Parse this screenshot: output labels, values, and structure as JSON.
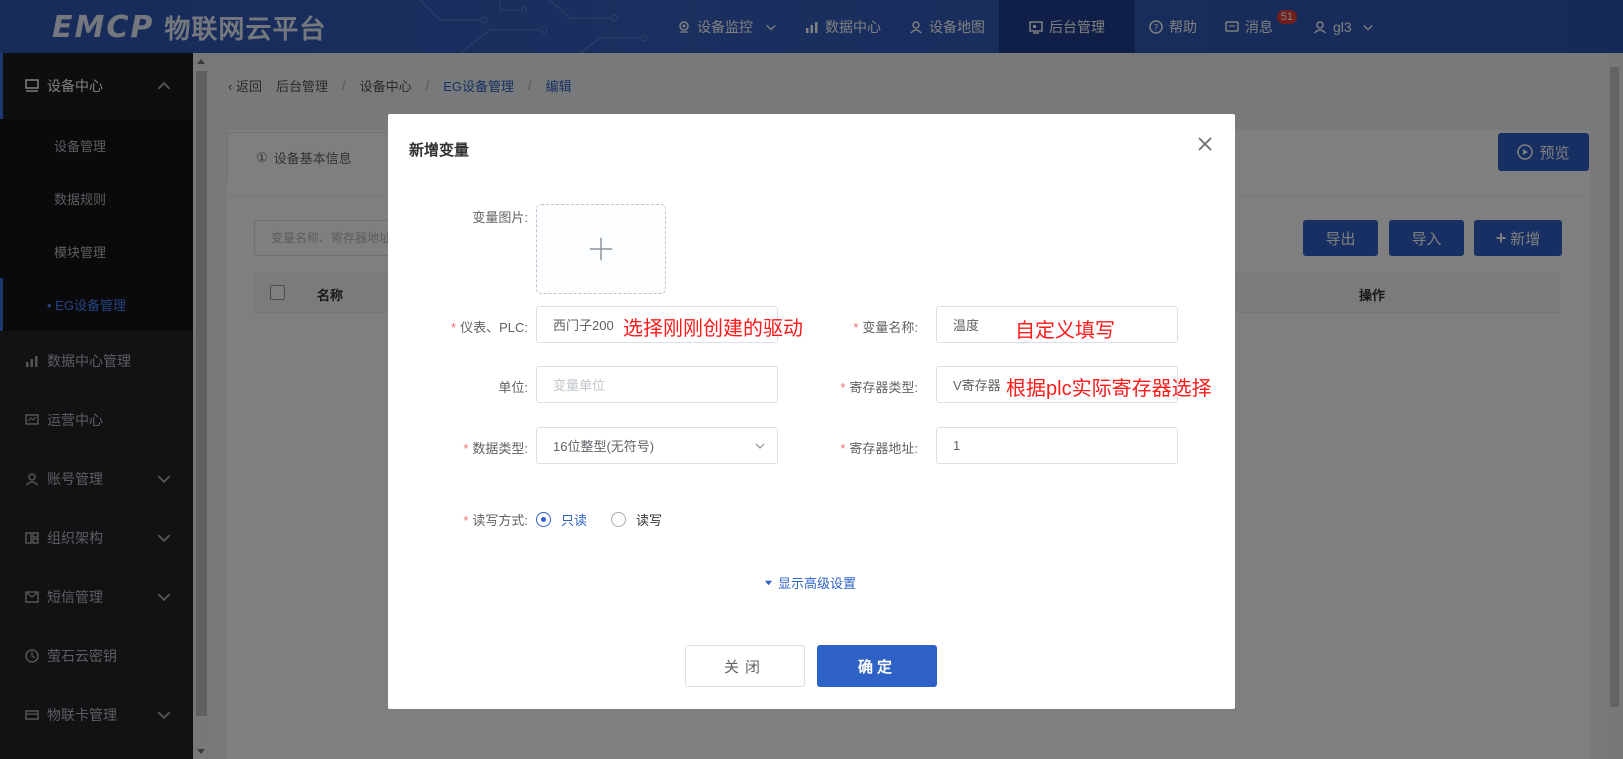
{
  "header": {
    "logo_mark": "EMCP",
    "logo_text": "物联网云平台",
    "nav": [
      {
        "label": "设备监控",
        "icon": "location-pin-icon",
        "has_dropdown": true
      },
      {
        "label": "数据中心",
        "icon": "bar-chart-icon"
      },
      {
        "label": "设备地图",
        "icon": "map-person-icon"
      },
      {
        "label": "后台管理",
        "icon": "admin-icon",
        "active": true
      },
      {
        "label": "帮助",
        "icon": "help-icon"
      },
      {
        "label": "消息",
        "icon": "message-icon",
        "badge": "51"
      },
      {
        "label": "gl3",
        "icon": "user-icon",
        "has_dropdown": true
      }
    ]
  },
  "sidebar": {
    "group": {
      "label": "设备中心",
      "icon": "device-center-icon"
    },
    "sub_items": [
      "设备管理",
      "数据规则",
      "模块管理",
      "• EG设备管理"
    ],
    "items": [
      {
        "label": "数据中心管理",
        "icon": "chart-icon"
      },
      {
        "label": "运营中心",
        "icon": "monitor-icon"
      },
      {
        "label": "账号管理",
        "icon": "person-icon",
        "chevron": true
      },
      {
        "label": "组织架构",
        "icon": "org-icon",
        "chevron": true
      },
      {
        "label": "短信管理",
        "icon": "sms-icon",
        "chevron": true
      },
      {
        "label": "萤石云密钥",
        "icon": "key-icon"
      },
      {
        "label": "物联卡管理",
        "icon": "card-icon",
        "chevron": true
      }
    ]
  },
  "breadcrumb": {
    "back": "返回",
    "items": [
      "后台管理",
      "设备中心",
      "EG设备管理",
      "编辑"
    ]
  },
  "background": {
    "tab_basic": "设备基本信息",
    "tab_basic_prefix": "①",
    "preview": "预览",
    "search_placeholder": "变量名称、寄存器地址",
    "export": "导出",
    "import": "导入",
    "add": "新增",
    "col_name": "名称",
    "col_action": "操作"
  },
  "dialog": {
    "title": "新增变量",
    "fields": {
      "image_label": "变量图片:",
      "plc_label": "仪表、PLC:",
      "plc_value": "西门子200",
      "var_name_label": "变量名称:",
      "var_name_value": "温度",
      "unit_label": "单位:",
      "unit_placeholder": "变量单位",
      "reg_type_label": "寄存器类型:",
      "reg_type_value": "V寄存器",
      "data_type_label": "数据类型:",
      "data_type_value": "16位整型(无符号)",
      "reg_addr_label": "寄存器地址:",
      "reg_addr_value": "1",
      "rw_label": "读写方式:",
      "rw_options": [
        "只读",
        "读写"
      ],
      "rw_selected": "只读"
    },
    "advanced": "显示高级设置",
    "close_btn": "关闭",
    "ok_btn": "确定"
  },
  "annotations": {
    "plc": "选择刚刚创建的驱动",
    "var_name": "自定义填写",
    "reg_type": "根据plc实际寄存器选择"
  },
  "colors": {
    "primary": "#2f62c7",
    "header": "#2e57b3",
    "sidebar": "#24252a",
    "annotation": "#ff1a1a",
    "required": "#f56c6c"
  }
}
